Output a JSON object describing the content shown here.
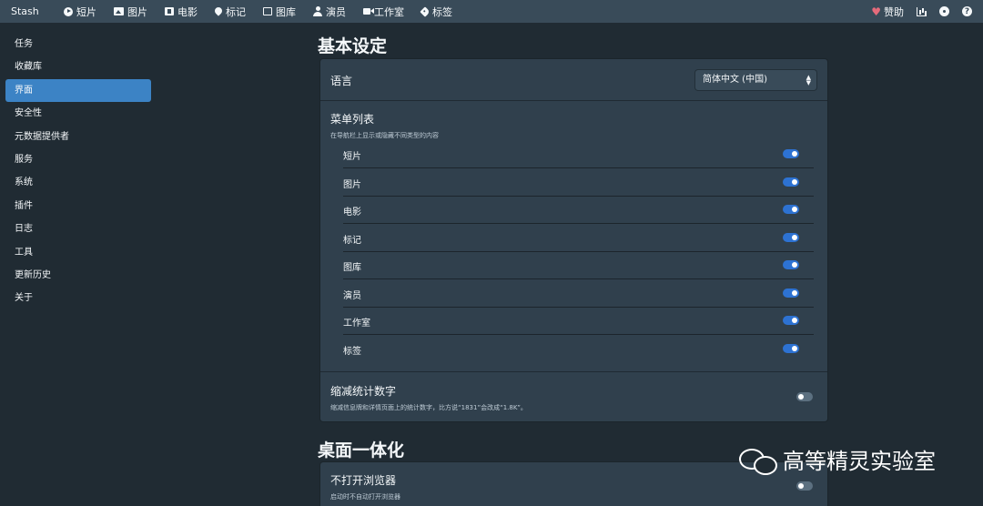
{
  "navbar": {
    "brand": "Stash",
    "items": [
      {
        "label": "短片",
        "icon": "play-circle-icon"
      },
      {
        "label": "图片",
        "icon": "image-icon"
      },
      {
        "label": "电影",
        "icon": "film-icon"
      },
      {
        "label": "标记",
        "icon": "map-marker-icon"
      },
      {
        "label": "图库",
        "icon": "images-icon"
      },
      {
        "label": "演员",
        "icon": "user-icon"
      },
      {
        "label": "工作室",
        "icon": "video-icon"
      },
      {
        "label": "标签",
        "icon": "tag-icon"
      }
    ],
    "donate_label": "赞助",
    "right_icons": [
      "heart-icon",
      "chart-icon",
      "gear-icon",
      "help-icon"
    ]
  },
  "sidebar": {
    "items": [
      "任务",
      "收藏库",
      "界面",
      "安全性",
      "元数据提供者",
      "服务",
      "系统",
      "插件",
      "日志",
      "工具",
      "更新历史",
      "关于"
    ],
    "active_index": 2
  },
  "basic": {
    "title": "基本设定",
    "language": {
      "label": "语言",
      "value": "简体中文 (中国)"
    },
    "menu": {
      "title": "菜单列表",
      "desc": "在导航栏上显示或隐藏不同类型的内容",
      "items": [
        {
          "label": "短片",
          "enabled": true
        },
        {
          "label": "图片",
          "enabled": true
        },
        {
          "label": "电影",
          "enabled": true
        },
        {
          "label": "标记",
          "enabled": true
        },
        {
          "label": "图库",
          "enabled": true
        },
        {
          "label": "演员",
          "enabled": true
        },
        {
          "label": "工作室",
          "enabled": true
        },
        {
          "label": "标签",
          "enabled": true
        }
      ]
    },
    "abbrev": {
      "title": "缩减统计数字",
      "desc": "缩减信息牌和详情页面上的统计数字，比方说“1831”会改成“1.8K”。",
      "enabled": false
    }
  },
  "desktop": {
    "title": "桌面一体化",
    "no_browser": {
      "title": "不打开浏览器",
      "desc": "启动时不自动打开浏览器",
      "enabled": false
    }
  },
  "watermark": {
    "text": "高等精灵实验室",
    "icon": "wechat-icon"
  },
  "colors": {
    "accent": "#3c83c5",
    "toggle_on": "#2d72d2",
    "card": "#30404d",
    "page": "#202b33",
    "navbar": "#394b59"
  }
}
